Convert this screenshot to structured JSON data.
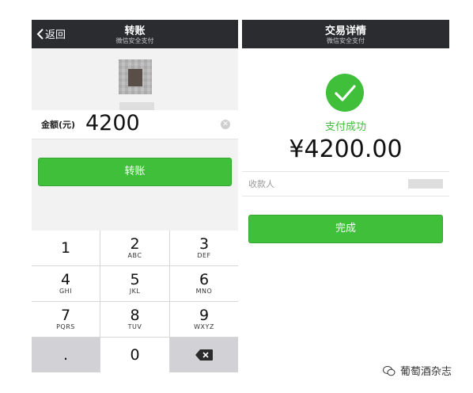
{
  "left_screen": {
    "back_label": "返回",
    "title": "转账",
    "subtitle": "微信安全支付",
    "amount_label": "金额(元)",
    "amount_value": "4200",
    "transfer_button": "转账",
    "keypad": [
      {
        "num": "1",
        "letters": ""
      },
      {
        "num": "2",
        "letters": "ABC"
      },
      {
        "num": "3",
        "letters": "DEF"
      },
      {
        "num": "4",
        "letters": "GHI"
      },
      {
        "num": "5",
        "letters": "JKL"
      },
      {
        "num": "6",
        "letters": "MNO"
      },
      {
        "num": "7",
        "letters": "PQRS"
      },
      {
        "num": "8",
        "letters": "TUV"
      },
      {
        "num": "9",
        "letters": "WXYZ"
      },
      {
        "num": ".",
        "letters": ""
      },
      {
        "num": "0",
        "letters": ""
      }
    ]
  },
  "right_screen": {
    "title": "交易详情",
    "subtitle": "微信安全支付",
    "status": "支付成功",
    "amount": "¥4200.00",
    "payee_label": "收款人",
    "done_button": "完成"
  },
  "watermark": {
    "text": "葡萄酒杂志"
  },
  "colors": {
    "accent_green": "#3fbf3a",
    "navbar": "#2b2c30"
  }
}
